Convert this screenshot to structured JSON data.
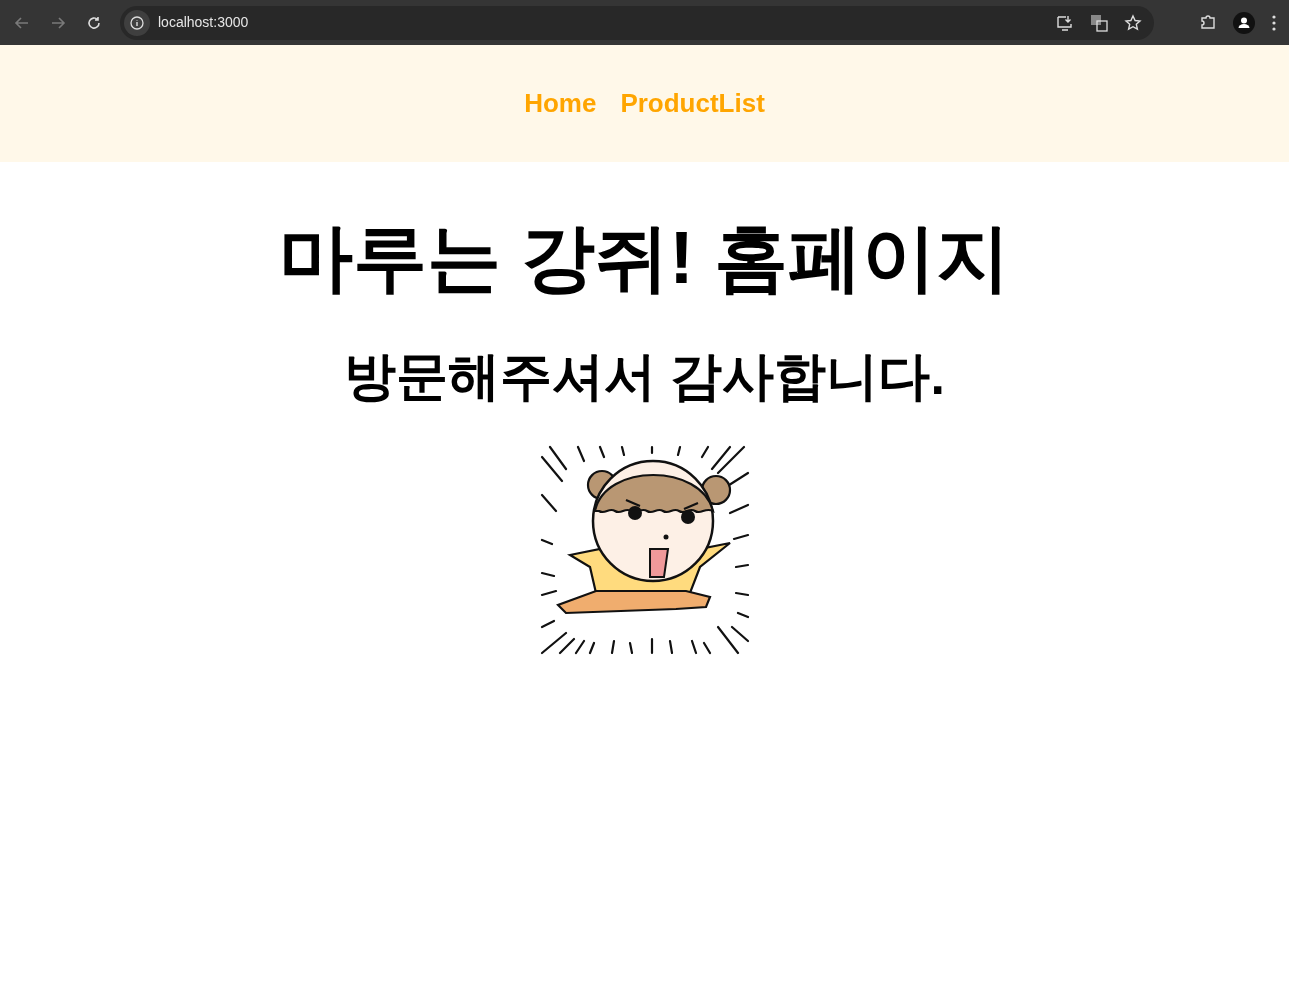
{
  "browser": {
    "url": "localhost:3000"
  },
  "nav": {
    "links": [
      {
        "label": "Home"
      },
      {
        "label": "ProductList"
      }
    ]
  },
  "heading": "마루는 강쥐! 홈페이지",
  "subheading": "방문해주셔서 감사합니다."
}
